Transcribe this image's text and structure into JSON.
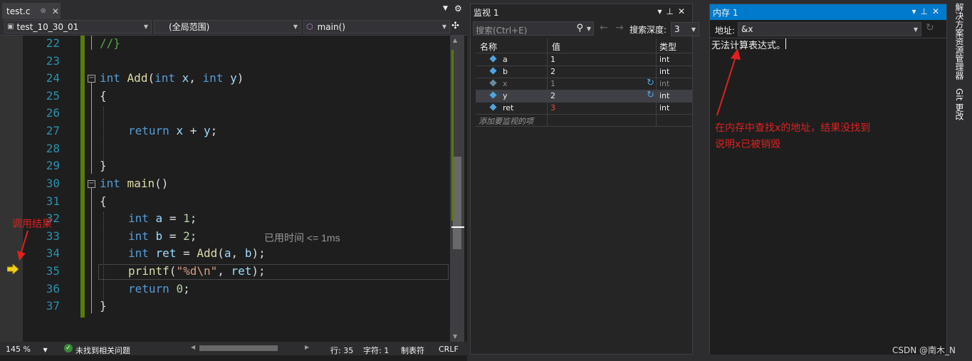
{
  "editor": {
    "tab_name": "test.c",
    "tab_pin": "⊕",
    "tab_close": "✕",
    "project": "test_10_30_01",
    "scope": "(全局范围)",
    "function": "main()",
    "lines": [
      {
        "num": "22",
        "text": "//}"
      },
      {
        "num": "23",
        "text": ""
      },
      {
        "num": "24",
        "text": "int Add(int x, int y)"
      },
      {
        "num": "25",
        "text": "{"
      },
      {
        "num": "26",
        "text": ""
      },
      {
        "num": "27",
        "text": "return x + y;"
      },
      {
        "num": "28",
        "text": ""
      },
      {
        "num": "29",
        "text": "}"
      },
      {
        "num": "30",
        "text": "int main()"
      },
      {
        "num": "31",
        "text": "{"
      },
      {
        "num": "32",
        "text": "int a = 1;"
      },
      {
        "num": "33",
        "text": "int b = 2;"
      },
      {
        "num": "34",
        "text": "int ret = Add(a, b);"
      },
      {
        "num": "35",
        "text": "printf(\"%d\\n\", ret);"
      },
      {
        "num": "36",
        "text": "return 0;"
      },
      {
        "num": "37",
        "text": "}"
      }
    ],
    "perf_tip": "已用时间 <= 1ms"
  },
  "status": {
    "zoom": "145 %",
    "issues": "未找到相关问题",
    "line": "行: 35",
    "col": "字符: 1",
    "tab_mode": "制表符",
    "eol": "CRLF"
  },
  "annotations": {
    "call_result": "调用结果",
    "memory_note_line1": "在内存中查找x的地址，结果没找到",
    "memory_note_line2": "说明x已被销毁"
  },
  "watch": {
    "title": "监视 1",
    "search_placeholder": "搜索(Ctrl+E)",
    "depth_label": "搜索深度:",
    "depth_value": "3",
    "columns": [
      "名称",
      "值",
      "类型"
    ],
    "rows": [
      {
        "name": "a",
        "value": "1",
        "type": "int",
        "stale": false,
        "changed": false,
        "refresh": false,
        "selected": false
      },
      {
        "name": "b",
        "value": "2",
        "type": "int",
        "stale": false,
        "changed": false,
        "refresh": false,
        "selected": false
      },
      {
        "name": "x",
        "value": "1",
        "type": "int",
        "stale": true,
        "changed": false,
        "refresh": true,
        "selected": false
      },
      {
        "name": "y",
        "value": "2",
        "type": "int",
        "stale": false,
        "changed": false,
        "refresh": true,
        "selected": true
      },
      {
        "name": "ret",
        "value": "3",
        "type": "int",
        "stale": false,
        "changed": true,
        "refresh": false,
        "selected": false
      }
    ],
    "add_placeholder": "添加要监视的项"
  },
  "memory": {
    "title": "内存 1",
    "address_label": "地址:",
    "address_value": "&x",
    "message": "无法计算表达式。"
  },
  "side_tabs": [
    "解决方案资源管理器",
    "Git 更改"
  ],
  "watermark": "CSDN @南木_N",
  "colors": {
    "accent": "#007acc",
    "change_bar": "#587c0c",
    "annotation": "#e02020",
    "changed_value": "#f44747"
  }
}
